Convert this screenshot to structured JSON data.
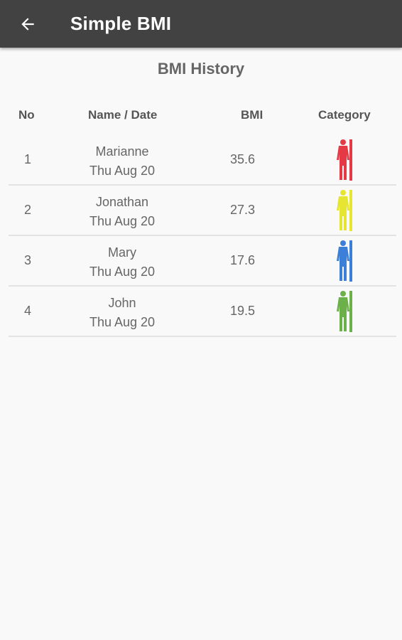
{
  "app_bar": {
    "title": "Simple BMI",
    "back_icon": "arrow-left-icon"
  },
  "page": {
    "section_title": "BMI History"
  },
  "table": {
    "headers": {
      "no": "No",
      "name_date": "Name / Date",
      "bmi": "BMI",
      "category": "Category"
    },
    "rows": [
      {
        "no": "1",
        "name": "Marianne",
        "date": "Thu Aug 20",
        "bmi": "35.6",
        "category_icon": "person-icon",
        "category_color": "#e53945"
      },
      {
        "no": "2",
        "name": "Jonathan",
        "date": "Thu Aug 20",
        "bmi": "27.3",
        "category_icon": "person-icon",
        "category_color": "#e5e532"
      },
      {
        "no": "3",
        "name": "Mary",
        "date": "Thu Aug 20",
        "bmi": "17.6",
        "category_icon": "person-icon",
        "category_color": "#3c7fd8"
      },
      {
        "no": "4",
        "name": "John",
        "date": "Thu Aug 20",
        "bmi": "19.5",
        "category_icon": "person-icon",
        "category_color": "#6cb049"
      }
    ]
  },
  "colors": {
    "app_bar": "#424242",
    "background": "#f9f9f9"
  }
}
